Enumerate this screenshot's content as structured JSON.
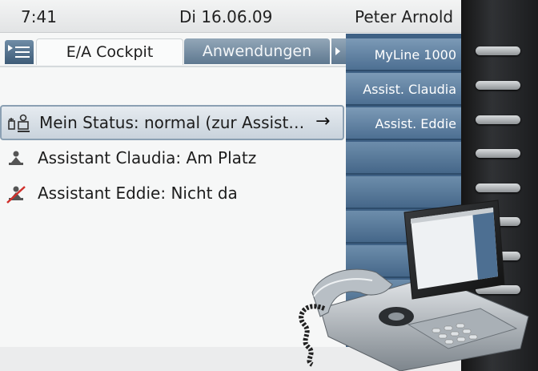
{
  "statusbar": {
    "time": "7:41",
    "date": "Di 16.06.09",
    "user": "Peter Arnold"
  },
  "tabs": {
    "menu_icon": "menu-icon",
    "active": "E/A Cockpit",
    "inactive": "Anwendungen",
    "more_icon": "tab-scroll-right-icon"
  },
  "list": {
    "items": [
      {
        "label": "Mein Status: normal (zur Assist…",
        "icon": "boss-assistant-status-icon",
        "trail_icon": "arrow-right-icon",
        "trail": "→"
      },
      {
        "label": "Assistant Claudia: Am Platz",
        "icon": "assistant-present-icon"
      },
      {
        "label": "Assistant Eddie: Nicht da",
        "icon": "assistant-absent-icon"
      }
    ]
  },
  "function_keys": [
    "MyLine 1000",
    "Assist. Claudia",
    "Assist. Eddie",
    "",
    "",
    "",
    "",
    ""
  ],
  "colors": {
    "accent_blue": "#4d6f92",
    "selected_row": "#c9d3dc",
    "absent_red": "#d0302b"
  }
}
